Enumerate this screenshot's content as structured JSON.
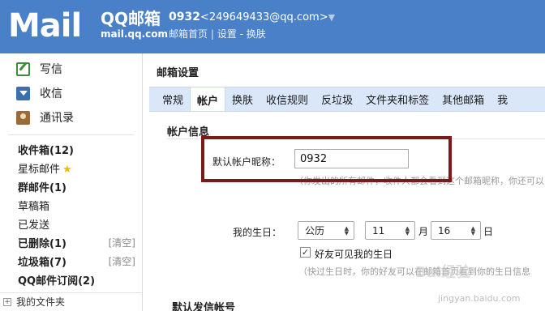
{
  "header": {
    "logo_text": "Mail",
    "brand_title": "QQ邮箱",
    "brand_url": "mail.qq.com",
    "account_uid": "0932",
    "account_email": "<249649433@qq.com>",
    "links": [
      "邮箱首页",
      "设置",
      "换肤"
    ],
    "link_sep": "|",
    "link_dash": "-"
  },
  "sidebar": {
    "actions": [
      {
        "label": "写信",
        "icon": "compose-icon"
      },
      {
        "label": "收信",
        "icon": "inbox-icon"
      },
      {
        "label": "通讯录",
        "icon": "contacts-icon"
      }
    ],
    "folders": [
      {
        "label": "收件箱(12)",
        "bold": true
      },
      {
        "label": "星标邮件",
        "bold": false,
        "star": "★"
      },
      {
        "label": "群邮件(1)",
        "bold": true
      },
      {
        "label": "草稿箱",
        "bold": false
      },
      {
        "label": "已发送",
        "bold": false
      },
      {
        "label": "已删除(1)",
        "bold": true,
        "clear": "[清空]"
      },
      {
        "label": "垃圾箱(7)",
        "bold": true,
        "clear": "[清空]"
      },
      {
        "label": "QQ邮件订阅(2)",
        "bold": true
      }
    ],
    "my_folders": "我的文件夹",
    "my_folders_toggle": "+"
  },
  "main": {
    "page_title": "邮箱设置",
    "tabs": [
      "常规",
      "帐户",
      "换肤",
      "收信规则",
      "反垃圾",
      "文件夹和标签",
      "其他邮箱",
      "我"
    ],
    "active_tab": 1,
    "section_title": "帐户信息",
    "nickname_label": "默认帐户昵称：",
    "nickname_value": "0932",
    "nickname_hint": "（你发出的所有邮件，收件人都会看到这个邮箱昵称，你还可以",
    "birthday_label": "我的生日：",
    "calendar": "公历",
    "month": "11",
    "month_unit": "月",
    "day": "16",
    "day_unit": "日",
    "friends_visible_label": "好友可见我的生日",
    "friends_visible_checked": true,
    "check_mark": "✓",
    "birthday_hint": "（快过生日时，你的好友可以在邮箱首页看到你的生日信息",
    "next_section_peek": "默认发信帐号"
  },
  "watermark": {
    "text": "Bai经验",
    "url": "jingyan.baidu.com"
  },
  "colors": {
    "header_bg": "#4a80c8",
    "tabbar_bg": "#d9e7f8",
    "highlight_border": "#7a1a1a"
  }
}
